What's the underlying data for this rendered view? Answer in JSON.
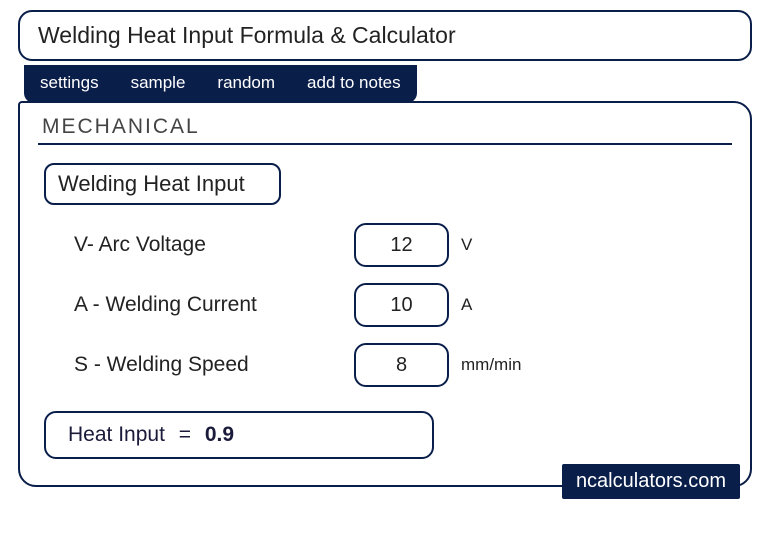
{
  "title": "Welding Heat Input Formula & Calculator",
  "tabs": {
    "settings": "settings",
    "sample": "sample",
    "random": "random",
    "add_to_notes": "add to notes"
  },
  "category": "MECHANICAL",
  "subtitle": "Welding Heat Input",
  "fields": {
    "voltage": {
      "label": "V- Arc Voltage",
      "value": "12",
      "unit": "V"
    },
    "current": {
      "label": "A - Welding Current",
      "value": "10",
      "unit": "A"
    },
    "speed": {
      "label": "S - Welding Speed",
      "value": "8",
      "unit": "mm/min"
    }
  },
  "result": {
    "label": "Heat Input",
    "eq": "=",
    "value": "0.9"
  },
  "brand": "ncalculators.com"
}
